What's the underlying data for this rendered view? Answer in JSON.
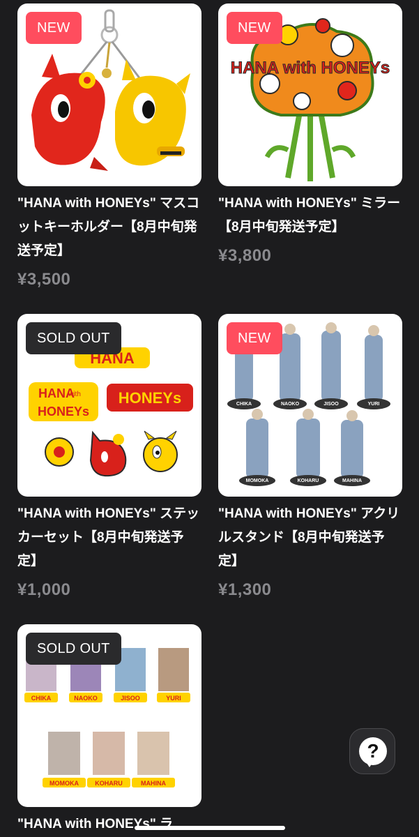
{
  "products": [
    {
      "badge": "NEW",
      "badge_type": "new",
      "title": "\"HANA with HONEYs\" マスコットキーホルダー【8月中旬発送予定】",
      "price": "¥3,500",
      "image_icon": "mascot-keyholder-image"
    },
    {
      "badge": "NEW",
      "badge_type": "new",
      "title": "\"HANA with HONEYs\" ミラー【8月中旬発送予定】",
      "price": "¥3,800",
      "image_icon": "mirror-image",
      "image_text": "HANA with HONEYs"
    },
    {
      "badge": "SOLD OUT",
      "badge_type": "sold",
      "title": "\"HANA with HONEYs\" ステッカーセット【8月中旬発送予定】",
      "price": "¥1,000",
      "image_icon": "sticker-set-image",
      "image_text": [
        "HANA",
        "HANA",
        "with",
        "HONEYs",
        "HONEYs"
      ]
    },
    {
      "badge": "NEW",
      "badge_type": "new",
      "title": "\"HANA with HONEYs\" アクリルスタンド【8月中旬発送予定】",
      "price": "¥1,300",
      "image_icon": "acrylic-stand-image",
      "image_text": [
        "CHIKA",
        "NAOKO",
        "JISOO",
        "YURI",
        "MOMOKA",
        "KOHARU",
        "MAHINA"
      ]
    },
    {
      "badge": "SOLD OUT",
      "badge_type": "sold",
      "title": "\"HANA with HONEYs\" ラ",
      "price": "",
      "image_icon": "photo-card-set-image",
      "image_text": [
        "CHIKA",
        "NAOKO",
        "JISOO",
        "YURI",
        "MOMOKA",
        "KOHARU",
        "MAHINA"
      ]
    }
  ],
  "help": {
    "label": "?",
    "icon": "question-icon"
  },
  "colors": {
    "background": "#1c1c1e",
    "badge_new": "#ff4d5e",
    "badge_sold": "#2a2a2c",
    "price": "#8a8a8e"
  }
}
